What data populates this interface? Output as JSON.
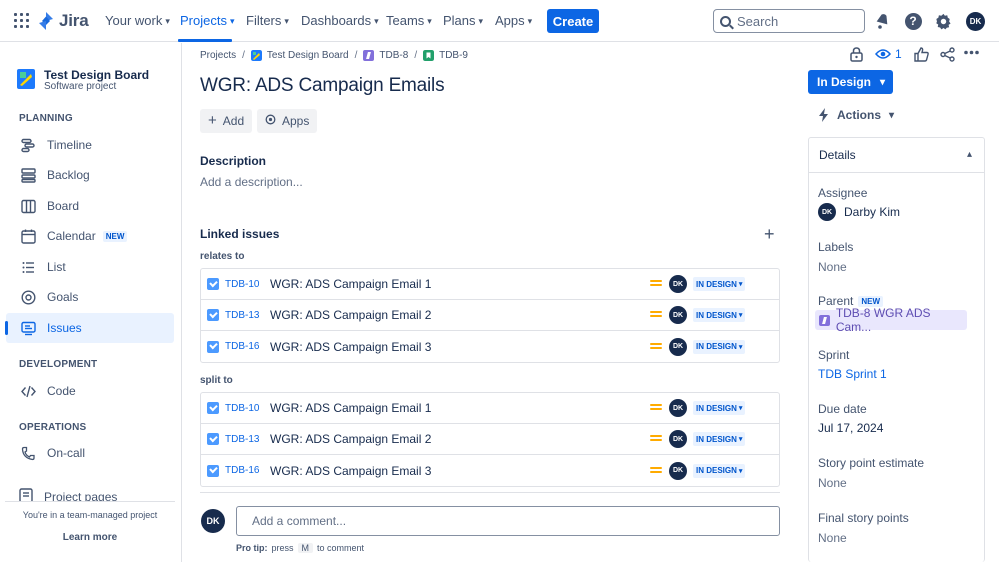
{
  "nav": {
    "logo_text": "Jira",
    "items": [
      {
        "label": "Your work"
      },
      {
        "label": "Projects"
      },
      {
        "label": "Filters"
      },
      {
        "label": "Dashboards"
      },
      {
        "label": "Teams"
      },
      {
        "label": "Plans"
      },
      {
        "label": "Apps"
      }
    ],
    "active_item": "Projects",
    "create_label": "Create",
    "search_placeholder": "Search",
    "user_initials": "DK",
    "accent_color": "#0c66e4"
  },
  "sidebar": {
    "project_name": "Test Design Board",
    "project_type": "Software project",
    "sections": [
      {
        "heading": "PLANNING",
        "items": [
          {
            "label": "Timeline",
            "icon": "timeline-icon"
          },
          {
            "label": "Backlog",
            "icon": "backlog-icon"
          },
          {
            "label": "Board",
            "icon": "board-icon"
          },
          {
            "label": "Calendar",
            "icon": "calendar-icon",
            "badge": "NEW"
          },
          {
            "label": "List",
            "icon": "list-icon"
          },
          {
            "label": "Goals",
            "icon": "goals-icon"
          },
          {
            "label": "Issues",
            "icon": "issues-icon",
            "active": true
          }
        ]
      },
      {
        "heading": "DEVELOPMENT",
        "items": [
          {
            "label": "Code",
            "icon": "code-icon"
          }
        ]
      },
      {
        "heading": "OPERATIONS",
        "items": [
          {
            "label": "On-call",
            "icon": "on-call-icon"
          }
        ]
      }
    ],
    "project_pages_label": "Project pages",
    "footer_text": "You're in a team-managed project",
    "learn_more": "Learn more"
  },
  "breadcrumb": {
    "items": [
      "Projects",
      "Test Design Board",
      "TDB-8",
      "TDB-9"
    ]
  },
  "issue": {
    "title": "WGR: ADS Campaign Emails",
    "add_label": "Add",
    "apps_label": "Apps",
    "description_heading": "Description",
    "description_placeholder": "Add a description...",
    "linked_heading": "Linked issues",
    "link_groups": [
      {
        "relation": "relates to",
        "issues": [
          {
            "key": "TDB-10",
            "summary": "WGR: ADS Campaign Email 1",
            "assignee": "DK",
            "status": "IN DESIGN"
          },
          {
            "key": "TDB-13",
            "summary": "WGR: ADS Campaign Email 2",
            "assignee": "DK",
            "status": "IN DESIGN"
          },
          {
            "key": "TDB-16",
            "summary": "WGR: ADS Campaign Email 3",
            "assignee": "DK",
            "status": "IN DESIGN"
          }
        ]
      },
      {
        "relation": "split to",
        "issues": [
          {
            "key": "TDB-10",
            "summary": "WGR: ADS Campaign Email 1",
            "assignee": "DK",
            "status": "IN DESIGN"
          },
          {
            "key": "TDB-13",
            "summary": "WGR: ADS Campaign Email 2",
            "assignee": "DK",
            "status": "IN DESIGN"
          },
          {
            "key": "TDB-16",
            "summary": "WGR: ADS Campaign Email 3",
            "assignee": "DK",
            "status": "IN DESIGN"
          }
        ]
      }
    ],
    "comment_avatar": "DK",
    "comment_placeholder": "Add a comment...",
    "protip_prefix": "Pro tip:",
    "protip_press": "press",
    "protip_key": "M",
    "protip_suffix": "to comment"
  },
  "right_panel": {
    "watchers_count": "1",
    "status_label": "In Design",
    "actions_label": "Actions",
    "details_heading": "Details",
    "assignee_label": "Assignee",
    "assignee_initials": "DK",
    "assignee_name": "Darby Kim",
    "labels_label": "Labels",
    "labels_value": "None",
    "parent_label": "Parent",
    "parent_badge": "NEW",
    "parent_value": "TDB-8 WGR ADS Cam...",
    "sprint_label": "Sprint",
    "sprint_value": "TDB Sprint 1",
    "due_label": "Due date",
    "due_value": "Jul 17, 2024",
    "spe_label": "Story point estimate",
    "spe_value": "None",
    "fsp_label": "Final story points",
    "fsp_value": "None"
  }
}
